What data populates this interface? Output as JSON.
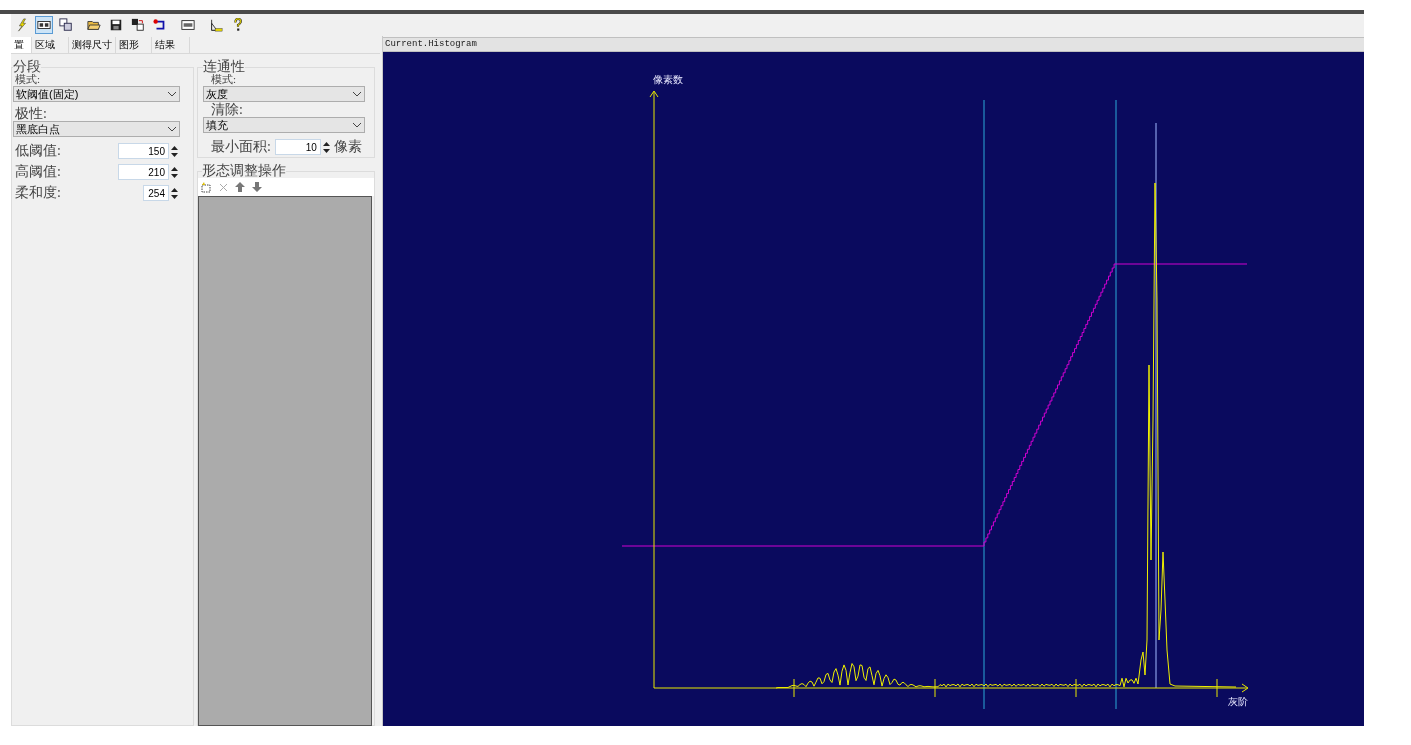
{
  "toolbar": [
    {
      "selected": false
    },
    {
      "selected": true
    },
    {
      "selected": false
    },
    {
      "selected": false
    },
    {
      "selected": false
    },
    {
      "selected": false
    },
    {
      "selected": false
    },
    {
      "selected": false
    },
    {
      "selected": false
    },
    {
      "selected": false
    }
  ],
  "tabs": [
    {
      "label": "置",
      "selected": true
    },
    {
      "label": "区域",
      "selected": false
    },
    {
      "label": "测得尺寸",
      "selected": false
    },
    {
      "label": "图形",
      "selected": false
    },
    {
      "label": "结果",
      "selected": false
    }
  ],
  "segmentation": {
    "title": "分段",
    "mode_label": "模式:",
    "mode_value": "软阈值(固定)",
    "polarity_label": "极性:",
    "polarity_value": "黑底白点",
    "spinners": [
      {
        "label": "低阈值:",
        "value": "150"
      },
      {
        "label": "高阈值:",
        "value": "210"
      },
      {
        "label": "柔和度:",
        "value": "254"
      }
    ]
  },
  "connectivity": {
    "title": "连通性",
    "mode_label": "模式:",
    "mode_value": "灰度",
    "clear_label": "清除:",
    "clear_value": "填充",
    "min_area_label": "最小面积:",
    "min_area_value": "10",
    "min_area_unit": "像素"
  },
  "morphology": {
    "title": "形态调整操作"
  },
  "histogram": {
    "title": "Current.Histogram",
    "y_label": "像素数",
    "x_label": "灰阶"
  }
}
